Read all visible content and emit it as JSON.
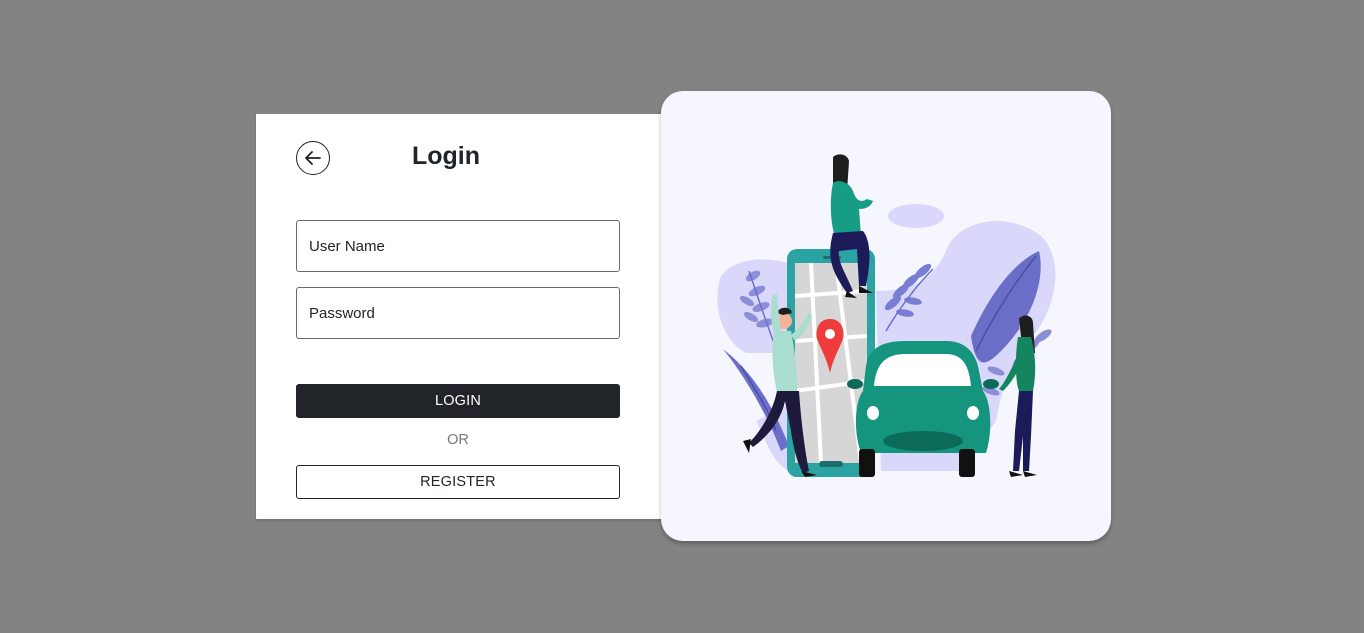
{
  "login": {
    "title": "Login",
    "back_icon": "arrow-left-icon",
    "username_placeholder": "User Name",
    "password_placeholder": "Password",
    "login_label": "LOGIN",
    "or_label": "OR",
    "register_label": "REGISTER"
  },
  "illustration": {
    "description_icon": "ride-booking-illustration"
  },
  "colors": {
    "background": "#838383",
    "dark_button": "#212529",
    "teal": "#1d9b8a",
    "lavender": "#d8d8f8",
    "pin": "#ef3b3b"
  }
}
